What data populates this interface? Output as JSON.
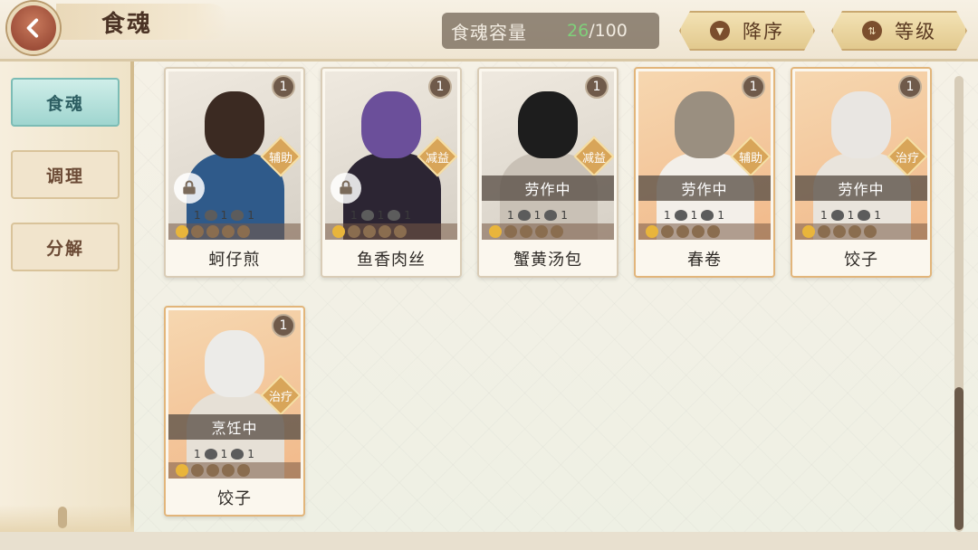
{
  "header": {
    "title": "食魂",
    "capacity_label": "食魂容量",
    "capacity_current": "26",
    "capacity_max": "/100",
    "sort_desc_label": "降序",
    "sort_level_label": "等级"
  },
  "sidebar": {
    "tabs": [
      {
        "label": "食魂",
        "active": true
      },
      {
        "label": "调理",
        "active": false
      },
      {
        "label": "分解",
        "active": false
      }
    ]
  },
  "cards": [
    {
      "name": "蚵仔煎",
      "count": "1",
      "role": "辅助",
      "status": "",
      "locked": true,
      "stat1": "1",
      "stat2": "1",
      "stat3": "1"
    },
    {
      "name": "鱼香肉丝",
      "count": "1",
      "role": "减益",
      "status": "",
      "locked": true,
      "stat1": "1",
      "stat2": "1",
      "stat3": "1"
    },
    {
      "name": "蟹黄汤包",
      "count": "1",
      "role": "减益",
      "status": "劳作中",
      "locked": false,
      "stat1": "1",
      "stat2": "1",
      "stat3": "1"
    },
    {
      "name": "春卷",
      "count": "1",
      "role": "辅助",
      "status": "劳作中",
      "locked": false,
      "stat1": "1",
      "stat2": "1",
      "stat3": "1"
    },
    {
      "name": "饺子",
      "count": "1",
      "role": "治疗",
      "status": "劳作中",
      "locked": false,
      "stat1": "1",
      "stat2": "1",
      "stat3": "1"
    },
    {
      "name": "饺子",
      "count": "1",
      "role": "治疗",
      "status": "烹饪中",
      "locked": false,
      "stat1": "1",
      "stat2": "1",
      "stat3": "1"
    }
  ]
}
